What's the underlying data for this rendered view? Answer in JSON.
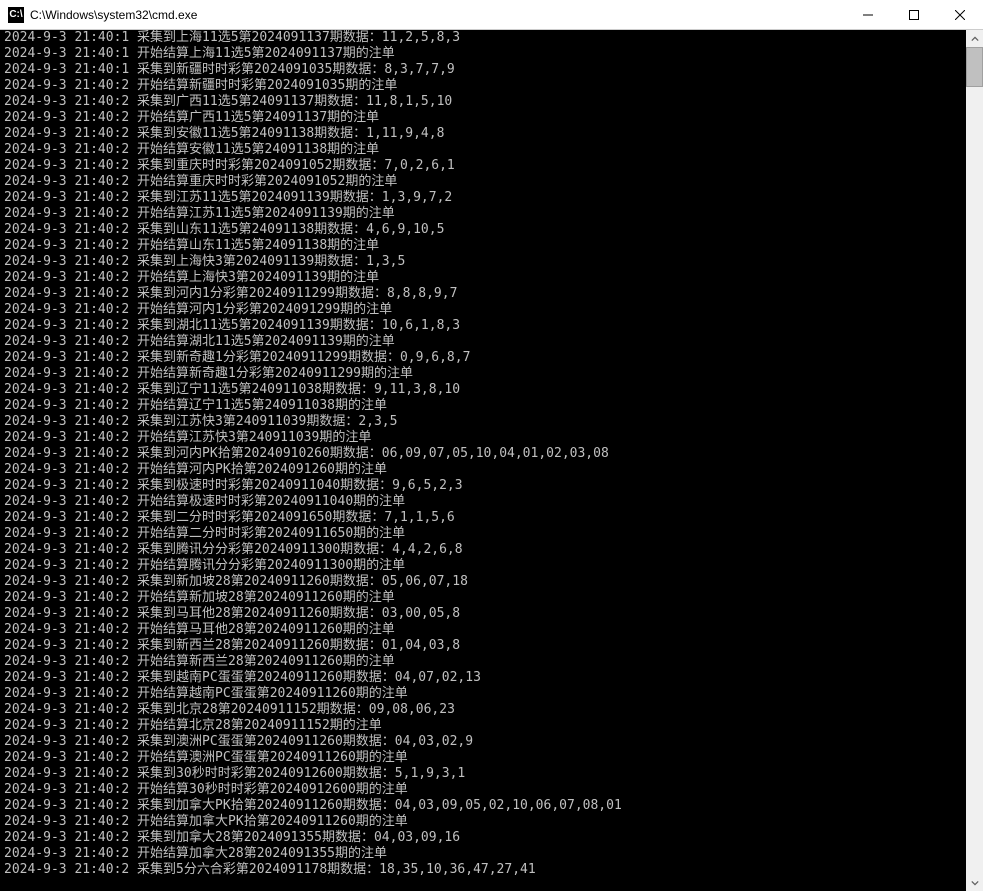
{
  "window": {
    "title": "C:\\Windows\\system32\\cmd.exe",
    "icon_label": "C:\\"
  },
  "lines": [
    "2024-9-3 21:40:1 采集到上海11选5第2024091137期数据：11,2,5,8,3",
    "2024-9-3 21:40:1 开始结算上海11选5第2024091137期的注单",
    "2024-9-3 21:40:1 采集到新疆时时彩第2024091035期数据：8,3,7,7,9",
    "2024-9-3 21:40:2 开始结算新疆时时彩第2024091035期的注单",
    "2024-9-3 21:40:2 采集到广西11选5第24091137期数据：11,8,1,5,10",
    "2024-9-3 21:40:2 开始结算广西11选5第24091137期的注单",
    "2024-9-3 21:40:2 采集到安徽11选5第24091138期数据：1,11,9,4,8",
    "2024-9-3 21:40:2 开始结算安徽11选5第24091138期的注单",
    "2024-9-3 21:40:2 采集到重庆时时彩第2024091052期数据：7,0,2,6,1",
    "2024-9-3 21:40:2 开始结算重庆时时彩第2024091052期的注单",
    "2024-9-3 21:40:2 采集到江苏11选5第2024091139期数据：1,3,9,7,2",
    "2024-9-3 21:40:2 开始结算江苏11选5第2024091139期的注单",
    "2024-9-3 21:40:2 采集到山东11选5第24091138期数据：4,6,9,10,5",
    "2024-9-3 21:40:2 开始结算山东11选5第24091138期的注单",
    "2024-9-3 21:40:2 采集到上海快3第2024091139期数据：1,3,5",
    "2024-9-3 21:40:2 开始结算上海快3第2024091139期的注单",
    "2024-9-3 21:40:2 采集到河内1分彩第20240911299期数据：8,8,8,9,7",
    "2024-9-3 21:40:2 开始结算河内1分彩第2024091299期的注单",
    "2024-9-3 21:40:2 采集到湖北11选5第2024091139期数据：10,6,1,8,3",
    "2024-9-3 21:40:2 开始结算湖北11选5第2024091139期的注单",
    "2024-9-3 21:40:2 采集到新奇趣1分彩第20240911299期数据：0,9,6,8,7",
    "2024-9-3 21:40:2 开始结算新奇趣1分彩第20240911299期的注单",
    "2024-9-3 21:40:2 采集到辽宁11选5第240911038期数据：9,11,3,8,10",
    "2024-9-3 21:40:2 开始结算辽宁11选5第240911038期的注单",
    "2024-9-3 21:40:2 采集到江苏快3第240911039期数据：2,3,5",
    "2024-9-3 21:40:2 开始结算江苏快3第240911039期的注单",
    "2024-9-3 21:40:2 采集到河内PK拾第20240910260期数据：06,09,07,05,10,04,01,02,03,08",
    "2024-9-3 21:40:2 开始结算河内PK拾第2024091260期的注单",
    "2024-9-3 21:40:2 采集到极速时时彩第20240911040期数据：9,6,5,2,3",
    "2024-9-3 21:40:2 开始结算极速时时彩第20240911040期的注单",
    "2024-9-3 21:40:2 采集到二分时时彩第2024091650期数据：7,1,1,5,6",
    "2024-9-3 21:40:2 开始结算二分时时彩第20240911650期的注单",
    "2024-9-3 21:40:2 采集到腾讯分分彩第20240911300期数据：4,4,2,6,8",
    "2024-9-3 21:40:2 开始结算腾讯分分彩第20240911300期的注单",
    "2024-9-3 21:40:2 采集到新加坡28第20240911260期数据：05,06,07,18",
    "2024-9-3 21:40:2 开始结算新加坡28第20240911260期的注单",
    "2024-9-3 21:40:2 采集到马耳他28第20240911260期数据：03,00,05,8",
    "2024-9-3 21:40:2 开始结算马耳他28第20240911260期的注单",
    "2024-9-3 21:40:2 采集到新西兰28第20240911260期数据：01,04,03,8",
    "2024-9-3 21:40:2 开始结算新西兰28第20240911260期的注单",
    "2024-9-3 21:40:2 采集到越南PC蛋蛋第20240911260期数据：04,07,02,13",
    "2024-9-3 21:40:2 开始结算越南PC蛋蛋第20240911260期的注单",
    "2024-9-3 21:40:2 采集到北京28第20240911152期数据：09,08,06,23",
    "2024-9-3 21:40:2 开始结算北京28第20240911152期的注单",
    "2024-9-3 21:40:2 采集到澳洲PC蛋蛋第20240911260期数据：04,03,02,9",
    "2024-9-3 21:40:2 开始结算澳洲PC蛋蛋第20240911260期的注单",
    "2024-9-3 21:40:2 采集到30秒时时彩第20240912600期数据：5,1,9,3,1",
    "2024-9-3 21:40:2 开始结算30秒时时彩第20240912600期的注单",
    "2024-9-3 21:40:2 采集到加拿大PK拾第20240911260期数据：04,03,09,05,02,10,06,07,08,01",
    "2024-9-3 21:40:2 开始结算加拿大PK拾第20240911260期的注单",
    "2024-9-3 21:40:2 采集到加拿大28第2024091355期数据：04,03,09,16",
    "2024-9-3 21:40:2 开始结算加拿大28第2024091355期的注单",
    "2024-9-3 21:40:2 采集到5分六合彩第2024091178期数据：18,35,10,36,47,27,41"
  ]
}
